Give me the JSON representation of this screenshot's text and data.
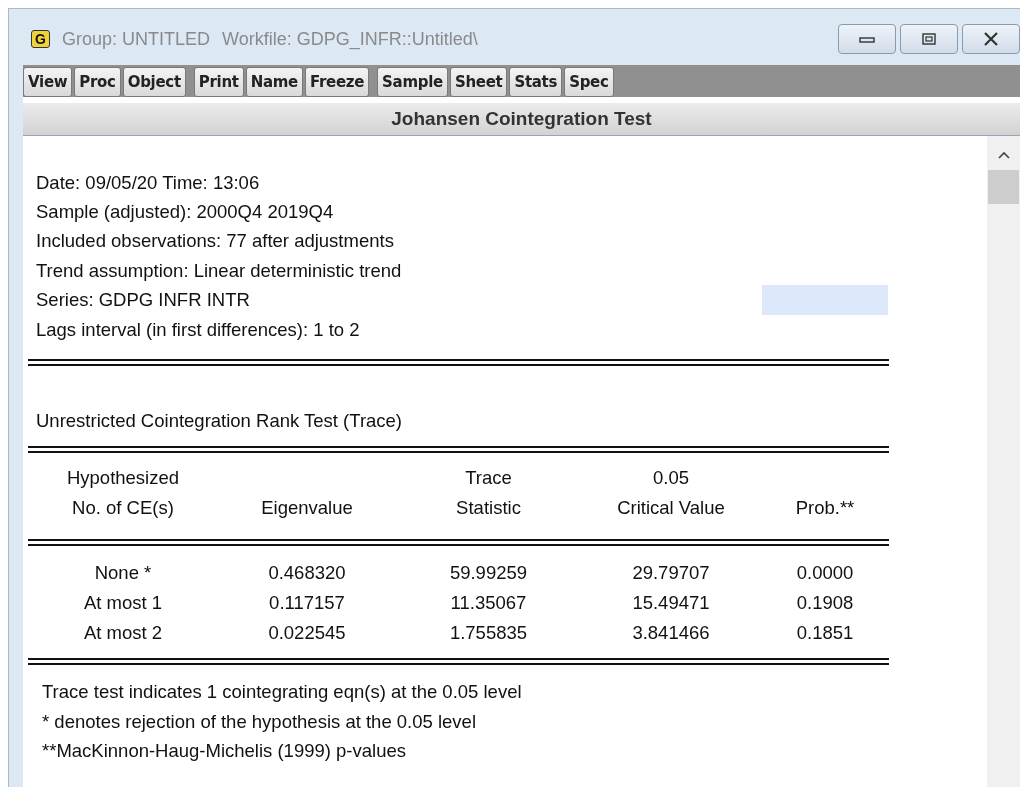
{
  "window": {
    "icon_letter": "G",
    "title_object": "Group: UNTITLED",
    "title_workfile": "Workfile: GDPG_INFR::Untitled\\"
  },
  "toolbar": [
    [
      "View",
      "Proc",
      "Object"
    ],
    [
      "Print",
      "Name",
      "Freeze"
    ],
    [
      "Sample",
      "Sheet",
      "Stats",
      "Spec"
    ]
  ],
  "view_title": "Johansen Cointegration Test",
  "info_lines": [
    {
      "text": "Date: 09/05/20   Time: 13:06",
      "highlighted": false
    },
    {
      "text": "Sample (adjusted): 2000Q4 2019Q4",
      "highlighted": false
    },
    {
      "text": "Included observations: 77 after adjustments",
      "highlighted": false
    },
    {
      "text": "Trend assumption: Linear deterministic trend",
      "highlighted": false
    },
    {
      "text": "Series: GDPG INFR INTR",
      "highlighted": true
    },
    {
      "text": "Lags interval (in first differences): 1 to 2",
      "highlighted": false
    }
  ],
  "section_title": "Unrestricted Cointegration Rank Test (Trace)",
  "table": {
    "header_rows": [
      [
        "Hypothesized",
        null,
        "Trace",
        "0.05",
        null
      ],
      [
        "No. of CE(s)",
        "Eigenvalue",
        "Statistic",
        "Critical Value",
        "Prob.**"
      ]
    ],
    "rows": [
      [
        "None *",
        "0.468320",
        "59.99259",
        "29.79707",
        "0.0000"
      ],
      [
        "At most 1",
        "0.117157",
        "11.35067",
        "15.49471",
        "0.1908"
      ],
      [
        "At most 2",
        "0.022545",
        "1.755835",
        "3.841466",
        "0.1851"
      ]
    ]
  },
  "notes": [
    "Trace test indicates 1 cointegrating eqn(s) at the 0.05 level",
    "* denotes rejection of the hypothesis at the 0.05 level",
    "**MacKinnon-Haug-Michelis (1999) p-values"
  ]
}
